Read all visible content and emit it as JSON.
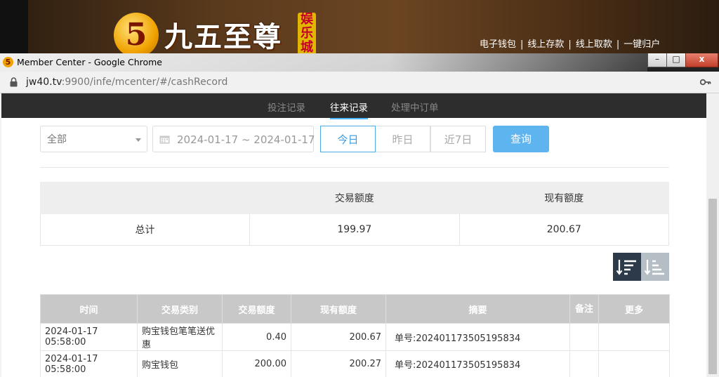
{
  "site_banner": {
    "logo_numeral": "5",
    "logo_text": "九五至尊",
    "logo_badge": "娱乐城",
    "links": [
      "电子钱包",
      "线上存款",
      "线上取款",
      "一键归户"
    ]
  },
  "window": {
    "title": "Member Center - Google Chrome",
    "controls": {
      "minimize": "–",
      "maximize": "□",
      "close": "x"
    }
  },
  "address_bar": {
    "host": "jw40.tv",
    "path": ":9900/infe/mcenter/#/cashRecord"
  },
  "tabs": [
    {
      "label": "投注记录",
      "active": false
    },
    {
      "label": "往来记录",
      "active": true
    },
    {
      "label": "处理中订单",
      "active": false
    }
  ],
  "filters": {
    "type_select": "全部",
    "date_range": "2024-01-17 ~ 2024-01-17",
    "ranges": [
      {
        "label": "今日",
        "active": true
      },
      {
        "label": "昨日",
        "active": false
      },
      {
        "label": "近7日",
        "active": false
      }
    ],
    "query_label": "查询"
  },
  "summary": {
    "headers": [
      "",
      "交易额度",
      "现有额度"
    ],
    "row": [
      "总计",
      "199.97",
      "200.67"
    ]
  },
  "records": {
    "headers": [
      "时间",
      "交易类别",
      "交易额度",
      "现有额度",
      "摘要",
      "备注",
      "更多"
    ],
    "rows": [
      [
        "2024-01-17 05:58:00",
        "购宝钱包笔笔送优惠",
        "0.40",
        "200.67",
        "单号:202401173505195834",
        "",
        ""
      ],
      [
        "2024-01-17 05:58:00",
        "购宝钱包",
        "200.00",
        "200.27",
        "单号:202401173505195834",
        "",
        ""
      ]
    ]
  }
}
